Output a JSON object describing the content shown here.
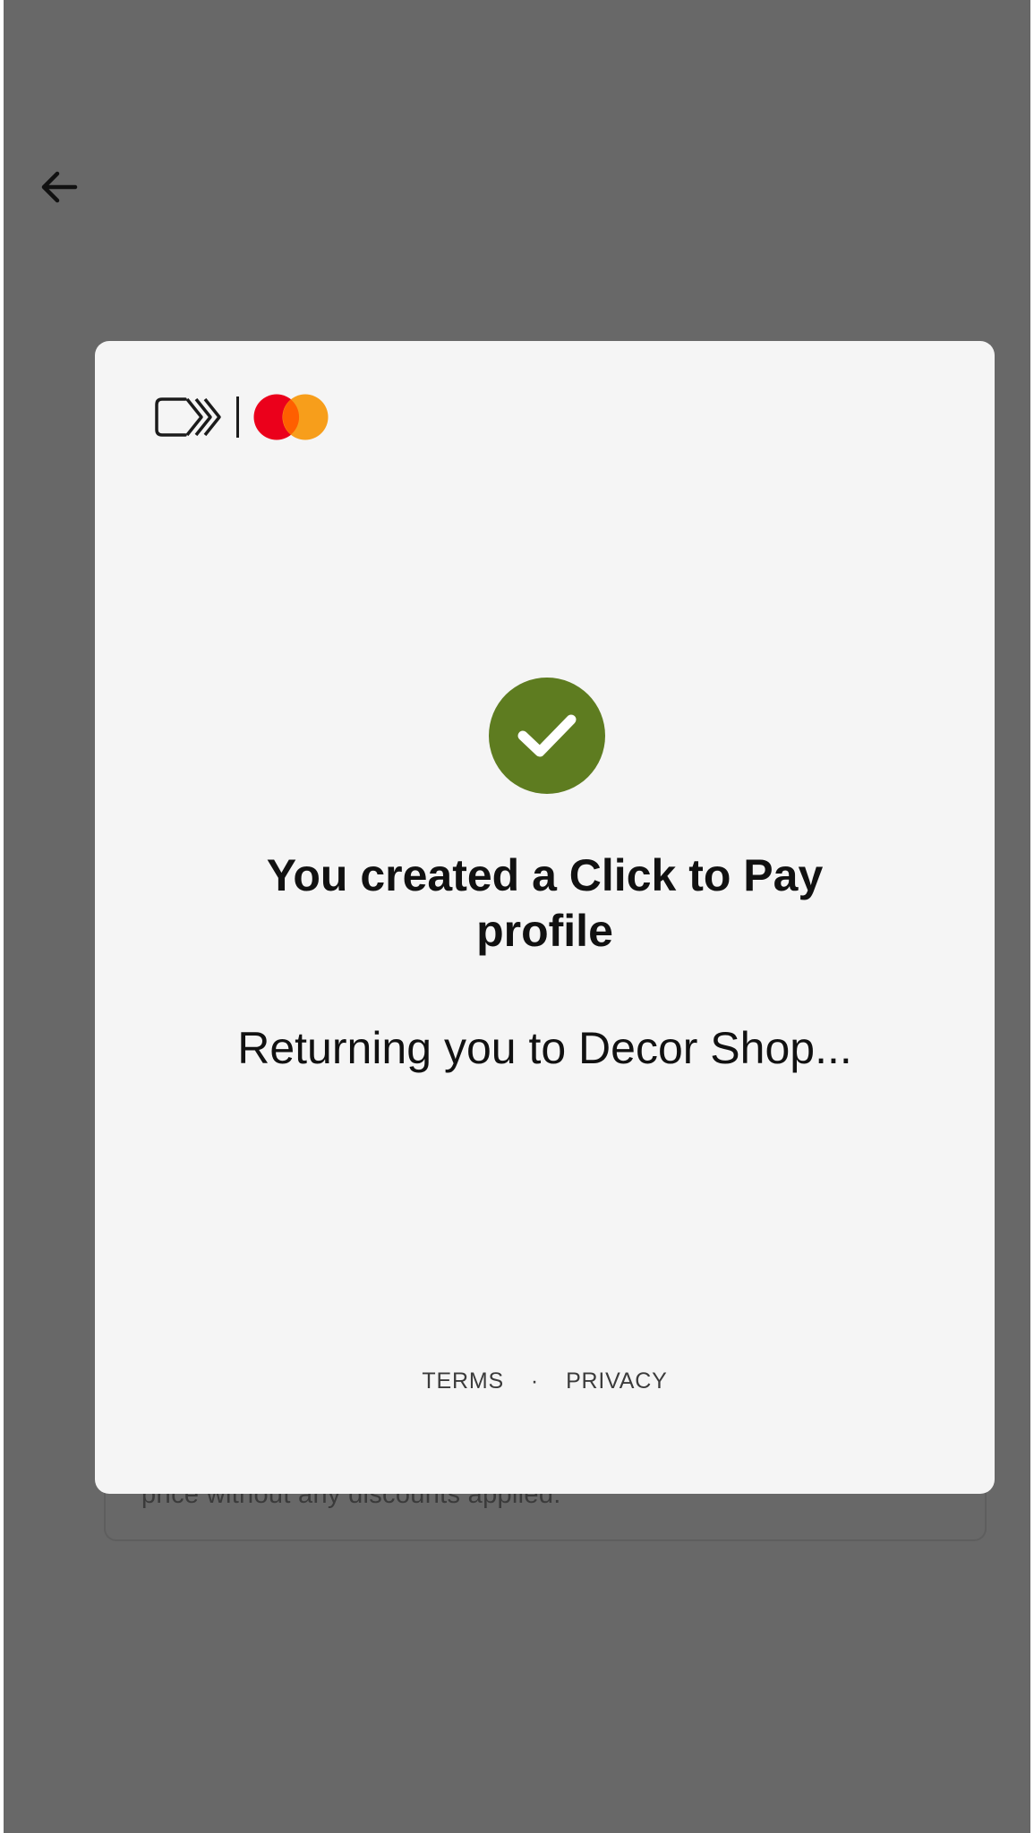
{
  "background": {
    "card_text": "price without any discounts applied."
  },
  "modal": {
    "title": "You created a Click to Pay profile",
    "message": "Returning you to Decor Shop...",
    "footer": {
      "terms": "TERMS",
      "separator": "·",
      "privacy": "PRIVACY"
    }
  },
  "icons": {
    "back": "arrow-left-icon",
    "brand": "click-to-pay-logo",
    "network": "mastercard-logo",
    "status": "checkmark-icon"
  },
  "colors": {
    "overlay": "#686868",
    "modal_bg": "#f5f5f5",
    "success": "#5e7c20",
    "mc_red": "#eb001b",
    "mc_orange": "#f79e1b"
  }
}
